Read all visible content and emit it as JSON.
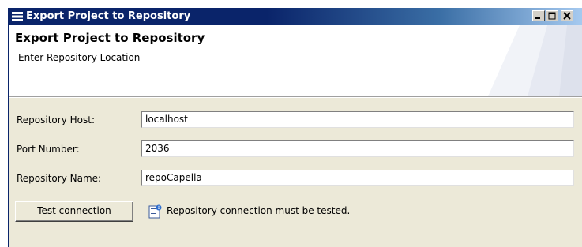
{
  "window": {
    "title": "Export Project to Repository"
  },
  "banner": {
    "title": "Export Project to Repository",
    "subtitle": "Enter Repository Location"
  },
  "form": {
    "host_label": "Repository Host:",
    "host_value": "localhost",
    "port_label": "Port Number:",
    "port_value": "2036",
    "name_label": "Repository Name:",
    "name_value": "repoCapella"
  },
  "actions": {
    "test_mnemonic": "T",
    "test_rest": "est connection",
    "status_message": "Repository connection must be tested."
  },
  "colors": {
    "titlebar": "#0a246a",
    "dialog_bg": "#ece9d8"
  }
}
